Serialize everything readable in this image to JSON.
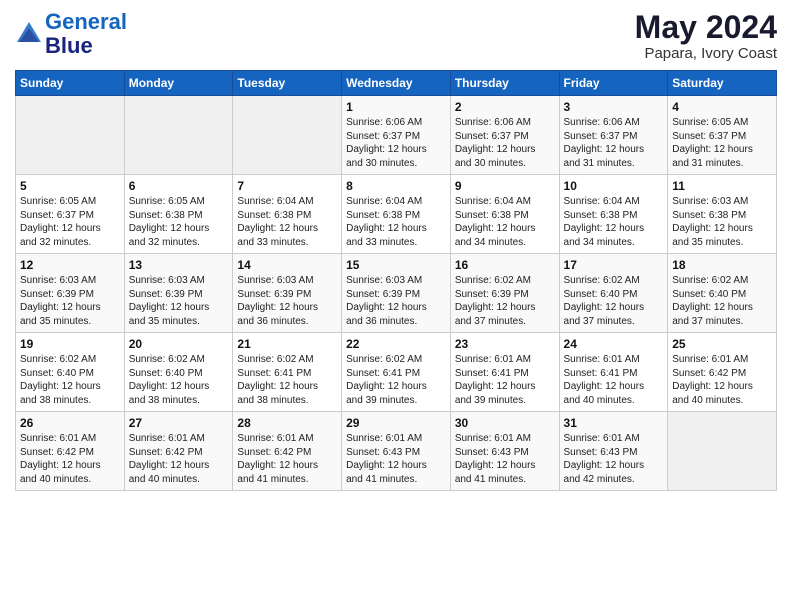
{
  "header": {
    "logo_line1": "General",
    "logo_line2": "Blue",
    "month_title": "May 2024",
    "location": "Papara, Ivory Coast"
  },
  "weekdays": [
    "Sunday",
    "Monday",
    "Tuesday",
    "Wednesday",
    "Thursday",
    "Friday",
    "Saturday"
  ],
  "weeks": [
    [
      {
        "num": "",
        "detail": ""
      },
      {
        "num": "",
        "detail": ""
      },
      {
        "num": "",
        "detail": ""
      },
      {
        "num": "1",
        "detail": "Sunrise: 6:06 AM\nSunset: 6:37 PM\nDaylight: 12 hours\nand 30 minutes."
      },
      {
        "num": "2",
        "detail": "Sunrise: 6:06 AM\nSunset: 6:37 PM\nDaylight: 12 hours\nand 30 minutes."
      },
      {
        "num": "3",
        "detail": "Sunrise: 6:06 AM\nSunset: 6:37 PM\nDaylight: 12 hours\nand 31 minutes."
      },
      {
        "num": "4",
        "detail": "Sunrise: 6:05 AM\nSunset: 6:37 PM\nDaylight: 12 hours\nand 31 minutes."
      }
    ],
    [
      {
        "num": "5",
        "detail": "Sunrise: 6:05 AM\nSunset: 6:37 PM\nDaylight: 12 hours\nand 32 minutes."
      },
      {
        "num": "6",
        "detail": "Sunrise: 6:05 AM\nSunset: 6:38 PM\nDaylight: 12 hours\nand 32 minutes."
      },
      {
        "num": "7",
        "detail": "Sunrise: 6:04 AM\nSunset: 6:38 PM\nDaylight: 12 hours\nand 33 minutes."
      },
      {
        "num": "8",
        "detail": "Sunrise: 6:04 AM\nSunset: 6:38 PM\nDaylight: 12 hours\nand 33 minutes."
      },
      {
        "num": "9",
        "detail": "Sunrise: 6:04 AM\nSunset: 6:38 PM\nDaylight: 12 hours\nand 34 minutes."
      },
      {
        "num": "10",
        "detail": "Sunrise: 6:04 AM\nSunset: 6:38 PM\nDaylight: 12 hours\nand 34 minutes."
      },
      {
        "num": "11",
        "detail": "Sunrise: 6:03 AM\nSunset: 6:38 PM\nDaylight: 12 hours\nand 35 minutes."
      }
    ],
    [
      {
        "num": "12",
        "detail": "Sunrise: 6:03 AM\nSunset: 6:39 PM\nDaylight: 12 hours\nand 35 minutes."
      },
      {
        "num": "13",
        "detail": "Sunrise: 6:03 AM\nSunset: 6:39 PM\nDaylight: 12 hours\nand 35 minutes."
      },
      {
        "num": "14",
        "detail": "Sunrise: 6:03 AM\nSunset: 6:39 PM\nDaylight: 12 hours\nand 36 minutes."
      },
      {
        "num": "15",
        "detail": "Sunrise: 6:03 AM\nSunset: 6:39 PM\nDaylight: 12 hours\nand 36 minutes."
      },
      {
        "num": "16",
        "detail": "Sunrise: 6:02 AM\nSunset: 6:39 PM\nDaylight: 12 hours\nand 37 minutes."
      },
      {
        "num": "17",
        "detail": "Sunrise: 6:02 AM\nSunset: 6:40 PM\nDaylight: 12 hours\nand 37 minutes."
      },
      {
        "num": "18",
        "detail": "Sunrise: 6:02 AM\nSunset: 6:40 PM\nDaylight: 12 hours\nand 37 minutes."
      }
    ],
    [
      {
        "num": "19",
        "detail": "Sunrise: 6:02 AM\nSunset: 6:40 PM\nDaylight: 12 hours\nand 38 minutes."
      },
      {
        "num": "20",
        "detail": "Sunrise: 6:02 AM\nSunset: 6:40 PM\nDaylight: 12 hours\nand 38 minutes."
      },
      {
        "num": "21",
        "detail": "Sunrise: 6:02 AM\nSunset: 6:41 PM\nDaylight: 12 hours\nand 38 minutes."
      },
      {
        "num": "22",
        "detail": "Sunrise: 6:02 AM\nSunset: 6:41 PM\nDaylight: 12 hours\nand 39 minutes."
      },
      {
        "num": "23",
        "detail": "Sunrise: 6:01 AM\nSunset: 6:41 PM\nDaylight: 12 hours\nand 39 minutes."
      },
      {
        "num": "24",
        "detail": "Sunrise: 6:01 AM\nSunset: 6:41 PM\nDaylight: 12 hours\nand 40 minutes."
      },
      {
        "num": "25",
        "detail": "Sunrise: 6:01 AM\nSunset: 6:42 PM\nDaylight: 12 hours\nand 40 minutes."
      }
    ],
    [
      {
        "num": "26",
        "detail": "Sunrise: 6:01 AM\nSunset: 6:42 PM\nDaylight: 12 hours\nand 40 minutes."
      },
      {
        "num": "27",
        "detail": "Sunrise: 6:01 AM\nSunset: 6:42 PM\nDaylight: 12 hours\nand 40 minutes."
      },
      {
        "num": "28",
        "detail": "Sunrise: 6:01 AM\nSunset: 6:42 PM\nDaylight: 12 hours\nand 41 minutes."
      },
      {
        "num": "29",
        "detail": "Sunrise: 6:01 AM\nSunset: 6:43 PM\nDaylight: 12 hours\nand 41 minutes."
      },
      {
        "num": "30",
        "detail": "Sunrise: 6:01 AM\nSunset: 6:43 PM\nDaylight: 12 hours\nand 41 minutes."
      },
      {
        "num": "31",
        "detail": "Sunrise: 6:01 AM\nSunset: 6:43 PM\nDaylight: 12 hours\nand 42 minutes."
      },
      {
        "num": "",
        "detail": ""
      }
    ]
  ]
}
